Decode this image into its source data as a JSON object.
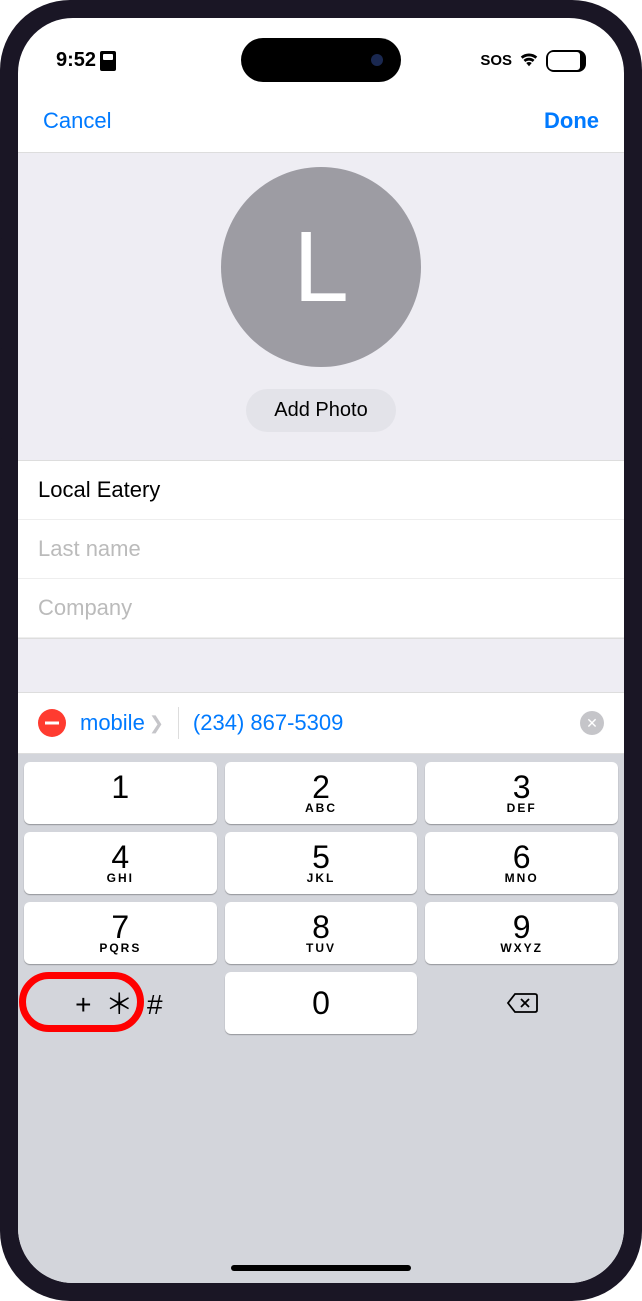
{
  "status": {
    "time": "9:52",
    "sos": "SOS",
    "battery": "80"
  },
  "nav": {
    "cancel": "Cancel",
    "done": "Done"
  },
  "photo": {
    "initial": "L",
    "add_btn": "Add Photo"
  },
  "fields": {
    "first_name": "Local Eatery",
    "last_name_placeholder": "Last name",
    "company_placeholder": "Company"
  },
  "phone": {
    "type": "mobile",
    "number": "(234) 867-5309"
  },
  "keypad": {
    "keys": [
      {
        "digit": "1",
        "letters": ""
      },
      {
        "digit": "2",
        "letters": "ABC"
      },
      {
        "digit": "3",
        "letters": "DEF"
      },
      {
        "digit": "4",
        "letters": "GHI"
      },
      {
        "digit": "5",
        "letters": "JKL"
      },
      {
        "digit": "6",
        "letters": "MNO"
      },
      {
        "digit": "7",
        "letters": "PQRS"
      },
      {
        "digit": "8",
        "letters": "TUV"
      },
      {
        "digit": "9",
        "letters": "WXYZ"
      }
    ],
    "symbols": "+ ＊ #",
    "zero": "0"
  }
}
